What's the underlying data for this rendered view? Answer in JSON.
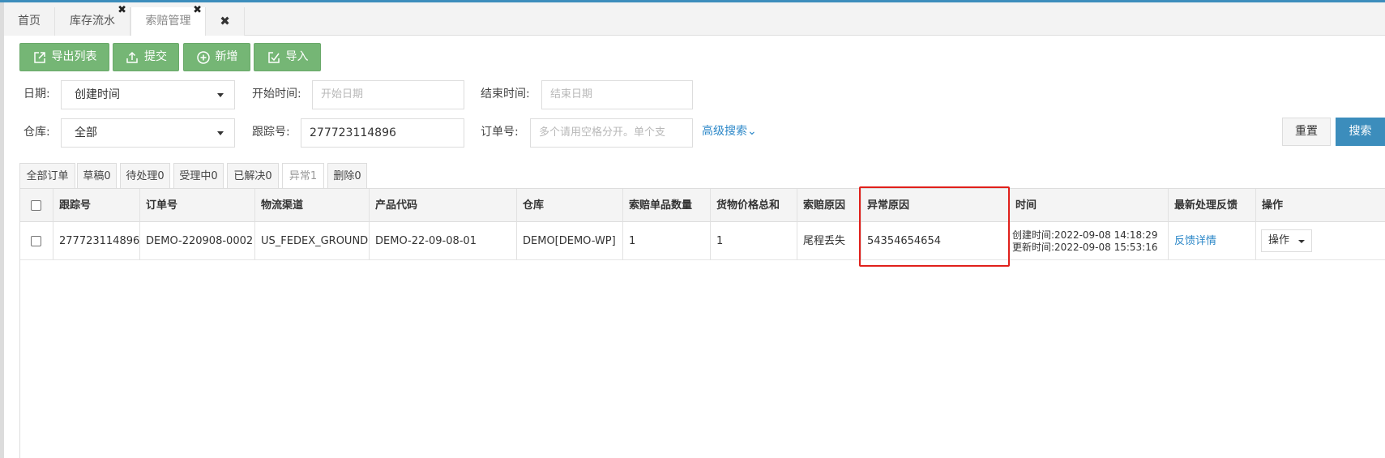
{
  "tabs": [
    {
      "label": "首页",
      "closable": false
    },
    {
      "label": "库存流水",
      "closable": true
    },
    {
      "label": "索赔管理",
      "closable": true,
      "active": true
    }
  ],
  "close_all_glyph": "✖",
  "tab_close_glyph": "✖",
  "toolbar": {
    "export_label": "导出列表",
    "submit_label": "提交",
    "add_label": "新增",
    "import_label": "导入"
  },
  "filters": {
    "date_label": "日期:",
    "date_value": "创建时间",
    "start_label": "开始时间:",
    "start_placeholder": "开始日期",
    "end_label": "结束时间:",
    "end_placeholder": "结束日期",
    "warehouse_label": "仓库:",
    "warehouse_value": "全部",
    "tracking_label": "跟踪号:",
    "tracking_value": "277723114896",
    "order_label": "订单号:",
    "order_placeholder": "多个请用空格分开。单个支",
    "advanced_label": "高级搜索⌄",
    "reset_label": "重置",
    "search_label": "搜索"
  },
  "status_tabs": [
    "全部订单",
    "草稿0",
    "待处理0",
    "受理中0",
    "已解决0",
    "异常1",
    "删除0"
  ],
  "table": {
    "headers": [
      "跟踪号",
      "订单号",
      "物流渠道",
      "产品代码",
      "仓库",
      "索赔单品数量",
      "货物价格总和",
      "索赔原因",
      "异常原因",
      "时间",
      "最新处理反馈",
      "操作"
    ],
    "rows": [
      {
        "tracking": "277723114896",
        "order": "DEMO-220908-0002",
        "channel": "US_FEDEX_GROUND",
        "product": "DEMO-22-09-08-01",
        "warehouse": "DEMO[DEMO-WP]",
        "qty": "1",
        "price_total": "1",
        "claim_reason": "尾程丢失",
        "exception_reason": "54354654654",
        "created": "创建时间:2022-09-08 14:18:29",
        "updated": "更新时间:2022-09-08 15:53:16",
        "feedback": "反馈详情",
        "action": "操作"
      }
    ]
  },
  "colors": {
    "accent": "#3c8dbc",
    "button_green": "#75b675",
    "highlight_red": "#e0201b",
    "link": "#2b87c8"
  }
}
